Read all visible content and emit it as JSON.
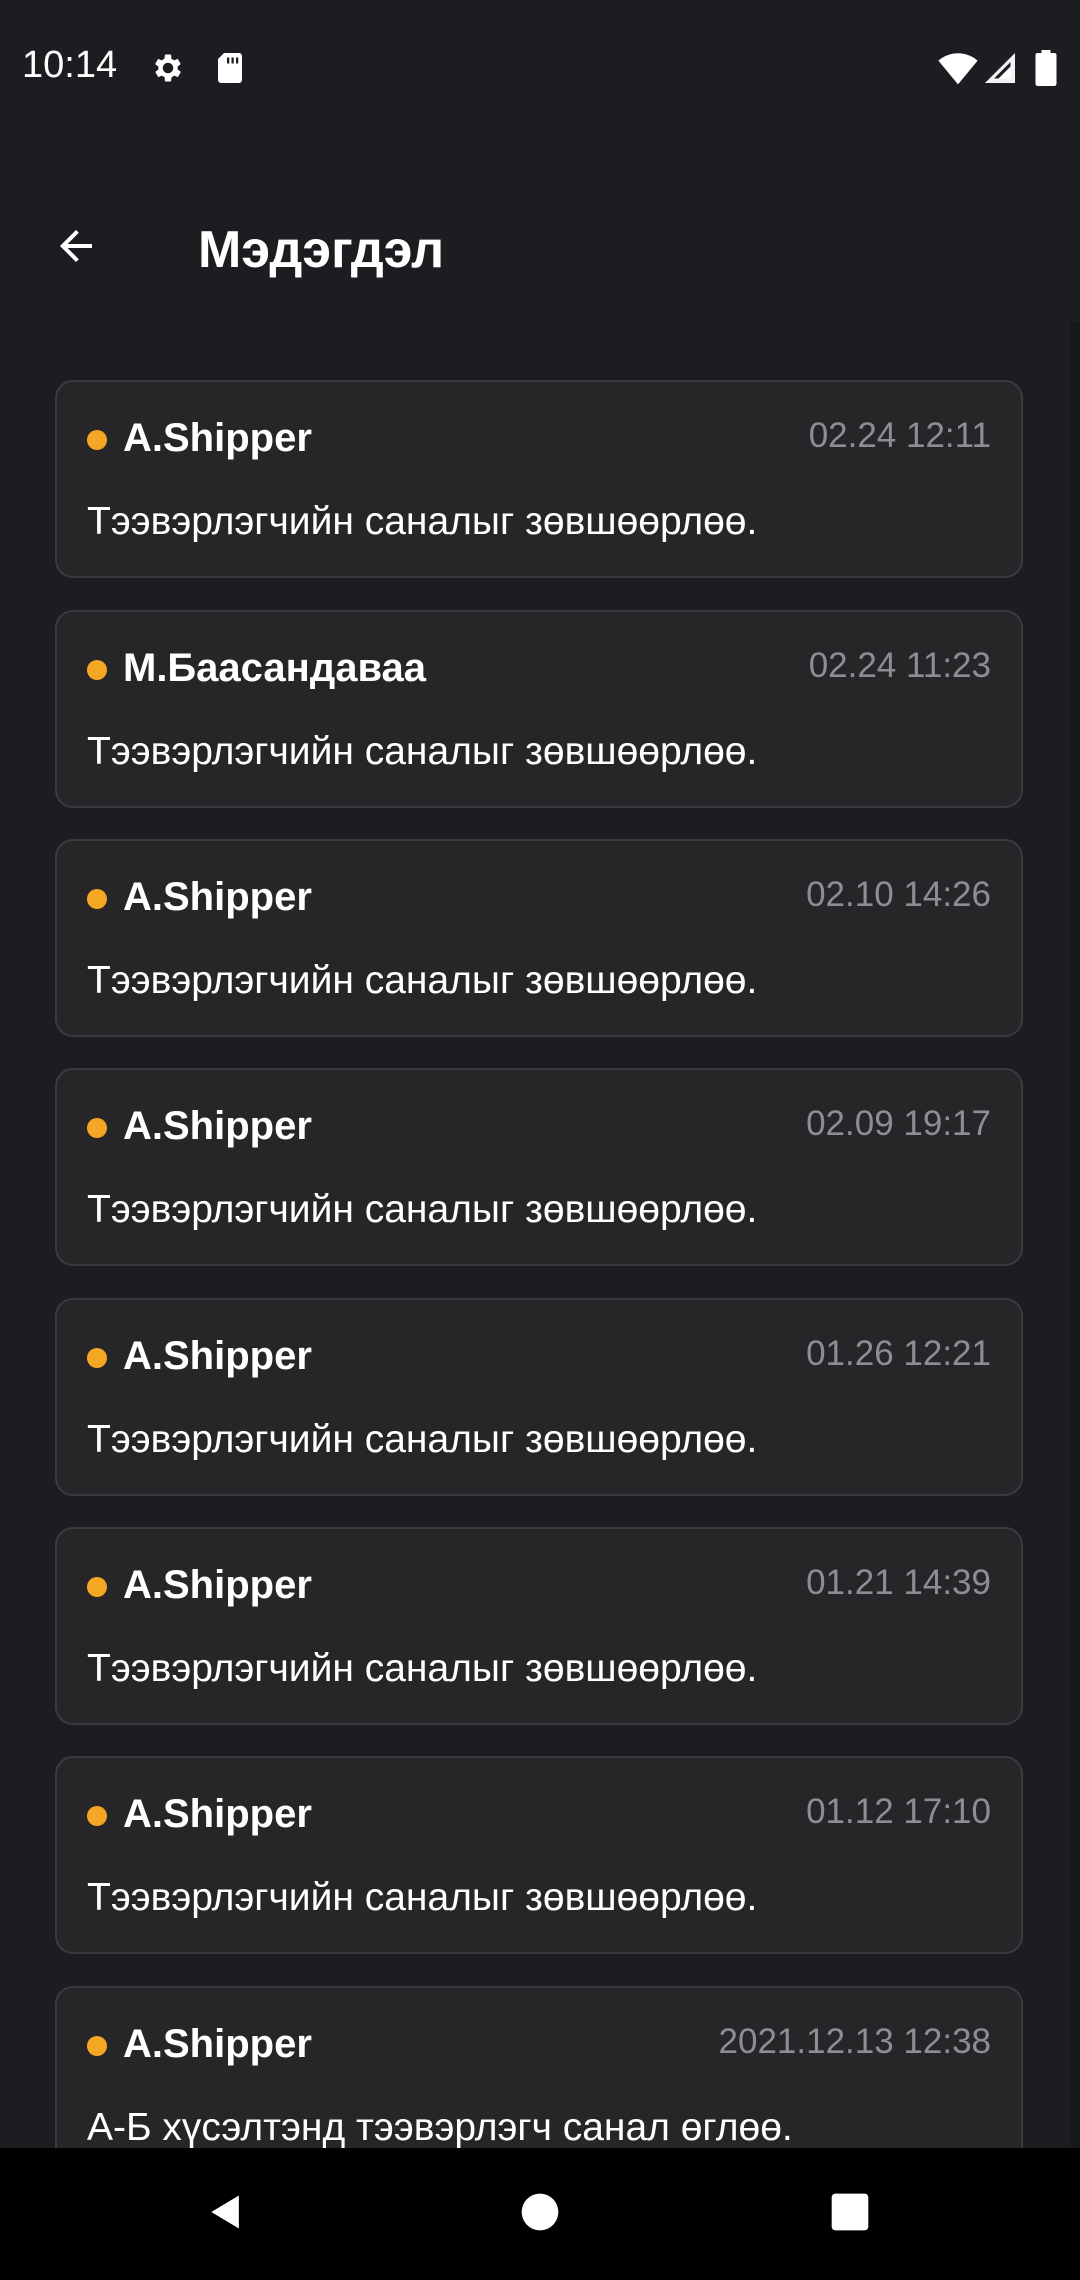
{
  "status_bar": {
    "time": "10:14",
    "left_icons": [
      "gear-icon",
      "sd-card-icon"
    ],
    "right_icons": [
      "wifi-icon",
      "signal-icon",
      "battery-icon"
    ]
  },
  "header": {
    "title": "Мэдэгдэл",
    "back_icon": "arrow-left-icon"
  },
  "notifications": [
    {
      "sender": "A.Shipper",
      "time": "02.24 12:11",
      "message": "Тээвэрлэгчийн саналыг зөвшөөрлөө.",
      "unread": true
    },
    {
      "sender": "М.Баасандаваа",
      "time": "02.24 11:23",
      "message": "Тээвэрлэгчийн саналыг зөвшөөрлөө.",
      "unread": true
    },
    {
      "sender": "A.Shipper",
      "time": "02.10 14:26",
      "message": "Тээвэрлэгчийн саналыг зөвшөөрлөө.",
      "unread": true
    },
    {
      "sender": "A.Shipper",
      "time": "02.09 19:17",
      "message": "Тээвэрлэгчийн саналыг зөвшөөрлөө.",
      "unread": true
    },
    {
      "sender": "A.Shipper",
      "time": "01.26 12:21",
      "message": "Тээвэрлэгчийн саналыг зөвшөөрлөө.",
      "unread": true
    },
    {
      "sender": "A.Shipper",
      "time": "01.21 14:39",
      "message": "Тээвэрлэгчийн саналыг зөвшөөрлөө.",
      "unread": true
    },
    {
      "sender": "A.Shipper",
      "time": "01.12 17:10",
      "message": "Тээвэрлэгчийн саналыг зөвшөөрлөө.",
      "unread": true
    },
    {
      "sender": "A.Shipper",
      "time": "2021.12.13 12:38",
      "message": "А-Б хүсэлтэнд тээвэрлэгч санал өглөө.",
      "unread": true
    }
  ],
  "nav_bar": {
    "buttons": [
      "back-triangle-icon",
      "home-circle-icon",
      "recents-square-icon"
    ]
  },
  "colors": {
    "background": "#1c1d21",
    "card": "#262629",
    "card_border": "#3a3b3f",
    "unread_dot": "#f5a623",
    "time_text": "#8d8e93",
    "nav_bar": "#000000"
  }
}
